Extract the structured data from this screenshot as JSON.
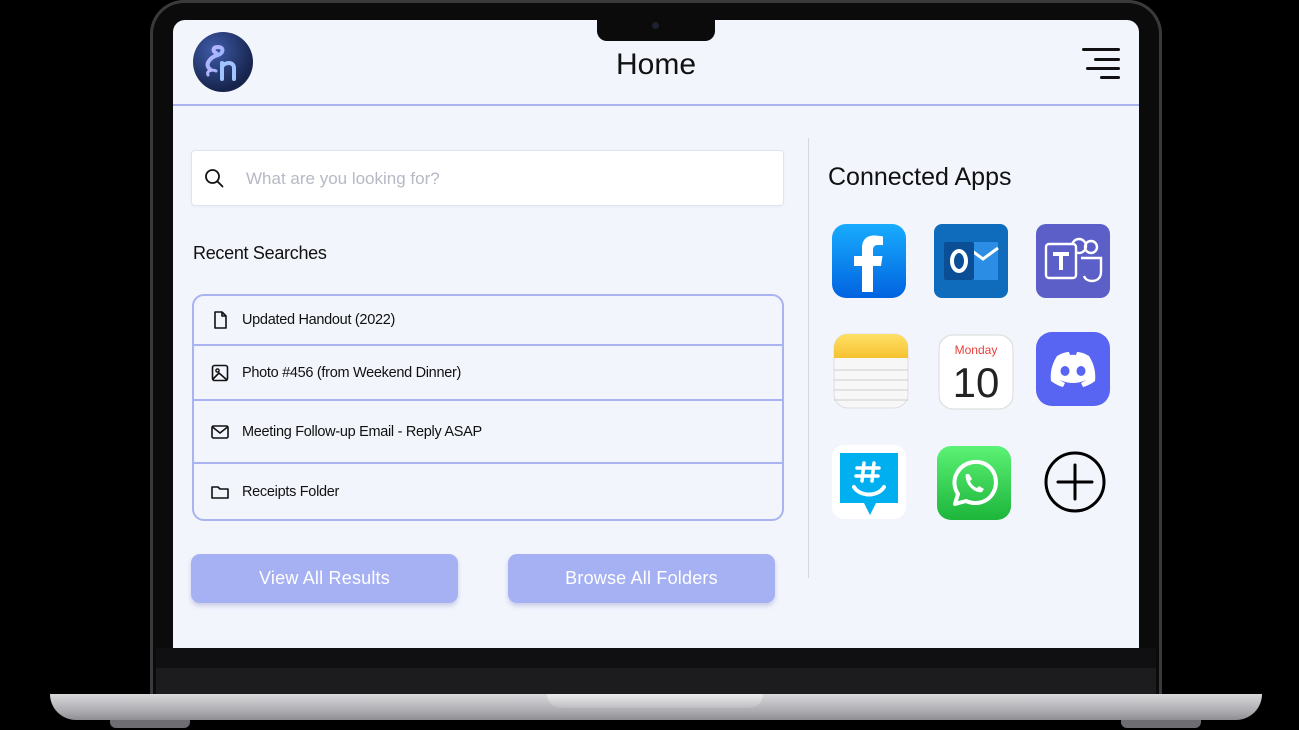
{
  "header": {
    "title": "Home",
    "logo_icon": "app-logo",
    "menu_icon": "menu-icon"
  },
  "search": {
    "placeholder": "What are you looking for?",
    "value": ""
  },
  "recent": {
    "title": "Recent Searches",
    "items": [
      {
        "label": "Updated Handout (2022)",
        "icon": "document-icon"
      },
      {
        "label": "Photo #456 (from Weekend Dinner)",
        "icon": "image-icon"
      },
      {
        "label": "Meeting Follow-up Email - Reply ASAP",
        "icon": "mail-icon"
      },
      {
        "label": "Receipts Folder",
        "icon": "folder-icon"
      }
    ]
  },
  "buttons": {
    "view_all": "View All Results",
    "browse_all": "Browse All Folders"
  },
  "apps": {
    "title": "Connected Apps",
    "items": [
      {
        "name": "Facebook",
        "icon": "facebook-icon"
      },
      {
        "name": "Outlook",
        "icon": "outlook-icon"
      },
      {
        "name": "Teams",
        "icon": "teams-icon"
      },
      {
        "name": "Notes",
        "icon": "notes-icon"
      },
      {
        "name": "Calendar",
        "icon": "calendar-icon",
        "weekday": "Monday",
        "day": "10"
      },
      {
        "name": "Discord",
        "icon": "discord-icon"
      },
      {
        "name": "GroupMe",
        "icon": "groupme-icon"
      },
      {
        "name": "WhatsApp",
        "icon": "whatsapp-icon"
      },
      {
        "name": "Add App",
        "icon": "add-circle-icon"
      }
    ]
  },
  "colors": {
    "accent": "#a9b3ef",
    "button": "#a6b1f3",
    "background": "#f3f5fd"
  }
}
